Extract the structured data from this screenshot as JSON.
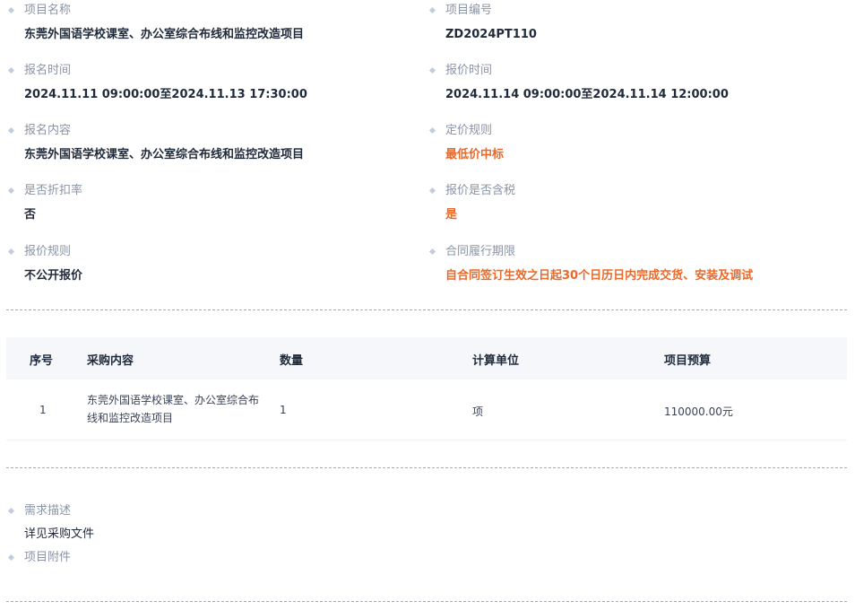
{
  "fields": {
    "project_name": {
      "label": "项目名称",
      "value": "东莞外国语学校课室、办公室综合布线和监控改造项目"
    },
    "project_no": {
      "label": "项目编号",
      "value": "ZD2024PT110"
    },
    "signup_time": {
      "label": "报名时间",
      "value": "2024.11.11 09:00:00至2024.11.13 17:30:00"
    },
    "quote_time": {
      "label": "报价时间",
      "value": "2024.11.14 09:00:00至2024.11.14 12:00:00"
    },
    "signup_content": {
      "label": "报名内容",
      "value": "东莞外国语学校课室、办公室综合布线和监控改造项目"
    },
    "pricing_rule": {
      "label": "定价规则",
      "value": "最低价中标"
    },
    "discount_rate": {
      "label": "是否折扣率",
      "value": "否"
    },
    "tax_included": {
      "label": "报价是否含税",
      "value": "是"
    },
    "quote_rule": {
      "label": "报价规则",
      "value": "不公开报价"
    },
    "contract_term": {
      "label": "合同履行期限",
      "value": "自合同签订生效之日起30个日历日内完成交货、安装及调试"
    }
  },
  "table": {
    "headers": [
      "序号",
      "采购内容",
      "数量",
      "计算单位",
      "项目预算"
    ],
    "rows": [
      {
        "no": "1",
        "content": "东莞外国语学校课室、办公室综合布线和监控改造项目",
        "qty": "1",
        "unit": "项",
        "budget": "110000.00元"
      }
    ]
  },
  "requirements": {
    "label": "需求描述",
    "value": "详见采购文件"
  },
  "attachments": {
    "label": "项目附件"
  },
  "colors": {
    "accent_orange": "#e8692a",
    "label_gray": "#8a94a6",
    "header_bg": "#f5f7fb"
  }
}
